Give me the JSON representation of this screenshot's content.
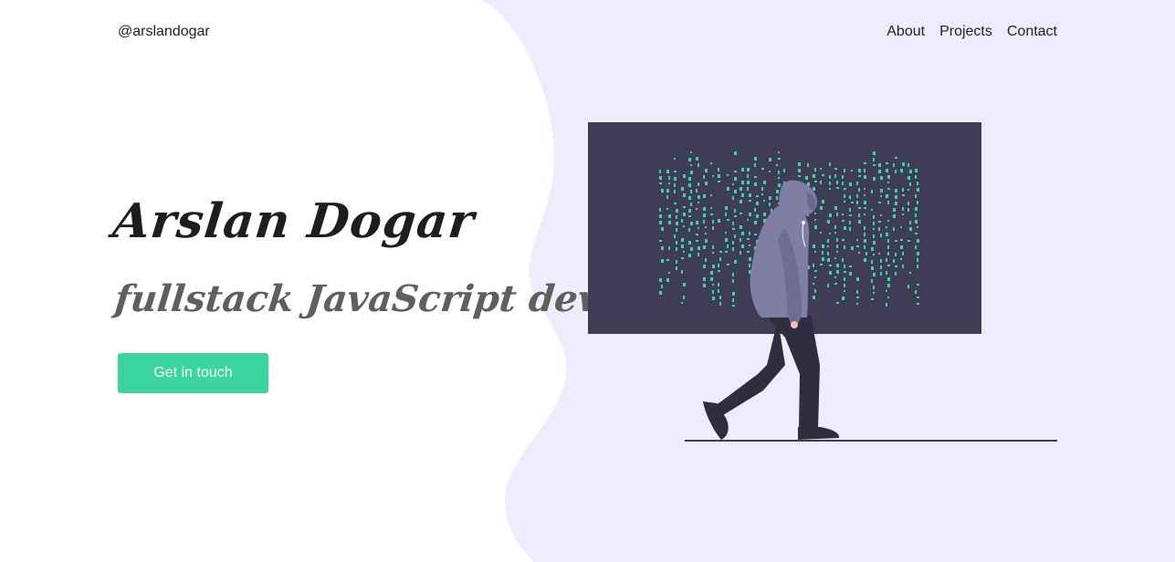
{
  "header": {
    "handle": "@arslandogar",
    "nav": [
      {
        "label": "About"
      },
      {
        "label": "Projects"
      },
      {
        "label": "Contact"
      }
    ]
  },
  "hero": {
    "name": "Arslan Dogar",
    "role": "fullstack JavaScript developer",
    "cta_label": "Get in touch"
  },
  "colors": {
    "accent": "#3bd5a0",
    "background_blob": "#eeedfd",
    "screen": "#3f3d56",
    "code": "#3bd5a0",
    "hoodie": "#817ea5",
    "pants": "#2f2e41"
  },
  "illustration": {
    "icon": "hacker-walking-illustration"
  }
}
